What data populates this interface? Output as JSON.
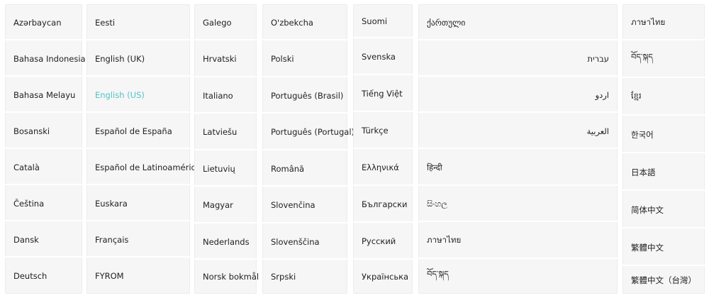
{
  "accent_color": "#4fc3c8",
  "columns": [
    {
      "items": [
        {
          "label": "Azərbaycan"
        },
        {
          "label": "Bahasa Indonesia"
        },
        {
          "label": "Bahasa Melayu"
        },
        {
          "label": "Bosanski"
        },
        {
          "label": "Català"
        },
        {
          "label": "Čeština"
        },
        {
          "label": "Dansk"
        },
        {
          "label": "Deutsch"
        }
      ]
    },
    {
      "items": [
        {
          "label": "Eesti"
        },
        {
          "label": "English (UK)"
        },
        {
          "label": "English (US)",
          "selected": true
        },
        {
          "label": "Español de España"
        },
        {
          "label": "Español de Latinoamérica"
        },
        {
          "label": "Euskara"
        },
        {
          "label": "Français"
        },
        {
          "label": "FYROM"
        }
      ]
    },
    {
      "items": [
        {
          "label": "Galego"
        },
        {
          "label": "Hrvatski"
        },
        {
          "label": "Italiano"
        },
        {
          "label": "Latviešu"
        },
        {
          "label": "Lietuvių"
        },
        {
          "label": "Magyar"
        },
        {
          "label": "Nederlands"
        },
        {
          "label": "Norsk bokmål"
        }
      ]
    },
    {
      "items": [
        {
          "label": "O'zbekcha"
        },
        {
          "label": "Polski"
        },
        {
          "label": "Português (Brasil)"
        },
        {
          "label": "Português (Portugal)"
        },
        {
          "label": "Română"
        },
        {
          "label": "Slovenčina"
        },
        {
          "label": "Slovenščina"
        },
        {
          "label": "Srpski"
        }
      ]
    },
    {
      "items": [
        {
          "label": "Suomi"
        },
        {
          "label": "Svenska"
        },
        {
          "label": "Tiếng Việt"
        },
        {
          "label": "Türkçe"
        },
        {
          "label": "Ελληνικά"
        },
        {
          "label": "Български"
        },
        {
          "label": "Русский"
        },
        {
          "label": "Українська"
        }
      ]
    },
    {
      "items": [
        {
          "label": "ქართული"
        },
        {
          "label": "עברית",
          "rtl": true
        },
        {
          "label": "اردو",
          "rtl": true
        },
        {
          "label": "العربية",
          "rtl": true
        },
        {
          "label": "हिन्दी"
        },
        {
          "label": "සිංහල"
        },
        {
          "label": "ภาษาไทย"
        },
        {
          "label": "བོད་སྐད"
        }
      ]
    },
    {
      "items": [
        {
          "label": "ภาษาไทย"
        },
        {
          "label": "བོད་སྐད"
        },
        {
          "label": "ខ្មែរ"
        },
        {
          "label": "한국어"
        },
        {
          "label": "日本語"
        },
        {
          "label": "简体中文"
        },
        {
          "label": "繁體中文"
        },
        {
          "label": "繁體中文（台灣）"
        }
      ]
    }
  ]
}
